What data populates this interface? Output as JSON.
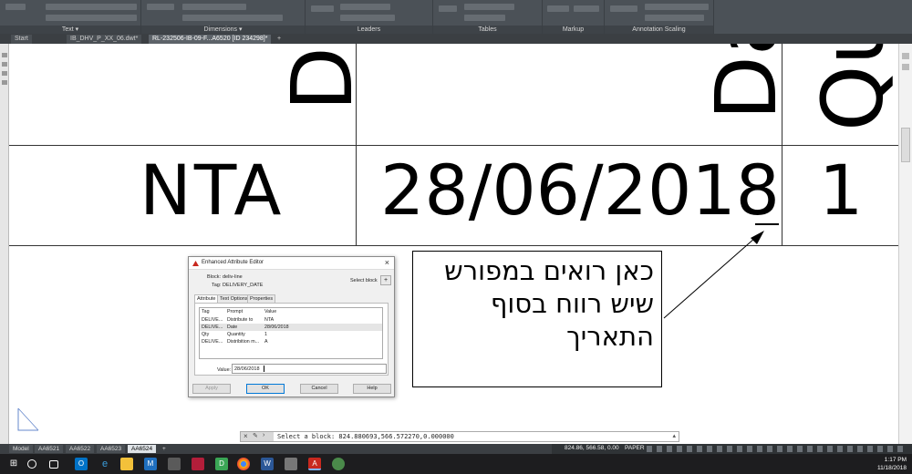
{
  "ribbon": {
    "groups": [
      {
        "label": "Text ▾"
      },
      {
        "label": "Dimensions ▾"
      },
      {
        "label": "Leaders"
      },
      {
        "label": "Tables"
      },
      {
        "label": "Markup"
      },
      {
        "label": "Annotation Scaling"
      }
    ]
  },
  "file_tabs": [
    {
      "label": "Start"
    },
    {
      "label": "IB_DHV_P_XX_06.dwt*"
    },
    {
      "label": "RL-232506-IB-09-F...A6520 [ID 234298]*"
    },
    {
      "label": "+"
    }
  ],
  "drawing": {
    "header_col1": "Dis",
    "header_col2": "Da",
    "header_col3": "Qu",
    "value_col1": "NTA",
    "value_col2": "28/06/2018",
    "value_col3": "1"
  },
  "callout": {
    "lines": [
      "כאן רואים במפורש",
      "שיש רווח בסוף",
      "התאריך"
    ]
  },
  "dialog": {
    "title": "Enhanced Attribute Editor",
    "block_label": "Block:",
    "block_value": "deliv-line",
    "tag_label": "Tag:",
    "tag_value": "DELIVERY_DATE",
    "select_block_label": "Select block",
    "tabs": [
      {
        "label": "Attribute"
      },
      {
        "label": "Text Options"
      },
      {
        "label": "Properties"
      }
    ],
    "columns": [
      "Tag",
      "Prompt",
      "Value"
    ],
    "rows": [
      {
        "tag": "DELIVE...",
        "prompt": "Distribute to",
        "value": "NTA"
      },
      {
        "tag": "DELIVE...",
        "prompt": "Date",
        "value": "28/06/2018"
      },
      {
        "tag": "Qty",
        "prompt": "Quantity",
        "value": "1"
      },
      {
        "tag": "DELIVE...",
        "prompt": "Distribition m...",
        "value": "A"
      }
    ],
    "value_label": "Value:",
    "value_input": "28/06/2018",
    "buttons": {
      "apply": "Apply",
      "ok": "OK",
      "cancel": "Cancel",
      "help": "Help"
    }
  },
  "command_line": {
    "text": "Select a block: 824.880693,566.572270,0.000000"
  },
  "layout_tabs": [
    {
      "label": "Model"
    },
    {
      "label": "AA6521"
    },
    {
      "label": "AA6522"
    },
    {
      "label": "AA6523"
    },
    {
      "label": "AA6524"
    },
    {
      "label": "+"
    }
  ],
  "status": {
    "coords": "824.86, 566.58, 0.00",
    "mode": "PAPER"
  },
  "taskbar": {
    "time": "1:17 PM",
    "date": "11/18/2018",
    "icons": [
      "start-icon",
      "search-icon",
      "task-view-icon",
      "outlook-icon",
      "edge-icon",
      "explorer-icon",
      "m-app-icon",
      "store-icon",
      "app-icon",
      "d-app-icon",
      "chrome-icon",
      "word-icon",
      "app-icon",
      "autocad-icon",
      "app-icon"
    ]
  },
  "colors": {
    "ribbon_bg": "#4b5157",
    "taskbar_bg": "#1d1d1f",
    "autocad_red": "#c8281e",
    "ok_border": "#0078d7"
  }
}
